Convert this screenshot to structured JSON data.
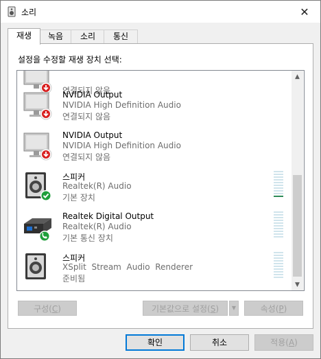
{
  "window": {
    "title": "소리",
    "close_glyph": "✕"
  },
  "tabs": [
    {
      "label": "재생",
      "active": true
    },
    {
      "label": "녹음",
      "active": false
    },
    {
      "label": "소리",
      "active": false
    },
    {
      "label": "통신",
      "active": false
    }
  ],
  "panel": {
    "caption": "설정을 수정할 재생 장치 선택:"
  },
  "devices": [
    {
      "name": "",
      "driver": "",
      "status": "연결되지 않음",
      "icon": "monitor-icon",
      "badge": "disconnected-badge-icon"
    },
    {
      "name": "NVIDIA Output",
      "driver": "NVIDIA High Definition Audio",
      "status": "연결되지 않음",
      "icon": "monitor-icon",
      "badge": "disconnected-badge-icon"
    },
    {
      "name": "NVIDIA Output",
      "driver": "NVIDIA High Definition Audio",
      "status": "연결되지 않음",
      "icon": "monitor-icon",
      "badge": "disconnected-badge-icon"
    },
    {
      "name": "스피커",
      "driver": "Realtek(R) Audio",
      "status": "기본 장치",
      "icon": "speaker-icon",
      "badge": "default-check-badge-icon",
      "meter_level": 0.05
    },
    {
      "name": "Realtek Digital Output",
      "driver": "Realtek(R) Audio",
      "status": "기본 통신 장치",
      "icon": "digital-output-icon",
      "badge": "default-comm-phone-badge-icon",
      "meter_level": 0
    },
    {
      "name": "스피커",
      "driver": "XSplit  Stream  Audio  Renderer",
      "status": "준비됨",
      "icon": "speaker-icon",
      "badge": "",
      "meter_level": 0
    }
  ],
  "panel_buttons": {
    "configure": {
      "label": "구성",
      "accel": "C"
    },
    "set_default": {
      "label": "기본값으로 설정",
      "accel": "S"
    },
    "properties": {
      "label": "속성",
      "accel": "P"
    }
  },
  "footer": {
    "ok": "확인",
    "cancel": "취소",
    "apply": {
      "label": "적용",
      "accel": "A"
    }
  },
  "colors": {
    "accent": "#0078d7",
    "meter": "#d0e4ec",
    "meter_active": "#2e8b57",
    "disconnected": "#d82020",
    "default_badge": "#1e9e3a"
  }
}
